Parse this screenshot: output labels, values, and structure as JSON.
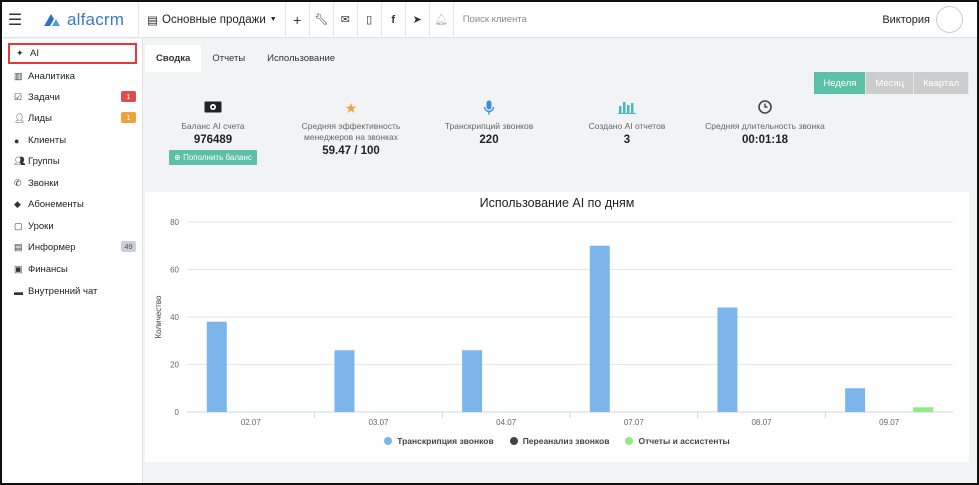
{
  "topbar": {
    "logo": "alfacrm",
    "branch": "Основные продажи",
    "search_placeholder": "Поиск клиента",
    "user_name": "Виктория"
  },
  "sidebar": {
    "items": [
      {
        "label": "AI",
        "icon": "sparkle-icon"
      },
      {
        "label": "Аналитика",
        "icon": "map-icon"
      },
      {
        "label": "Задачи",
        "icon": "tasks-icon",
        "badge": "1",
        "badge_color": "#e24b4b"
      },
      {
        "label": "Лиды",
        "icon": "leads-icon",
        "badge": "1",
        "badge_color": "#f0a23a"
      },
      {
        "label": "Клиенты",
        "icon": "user-icon"
      },
      {
        "label": "Группы",
        "icon": "users-icon"
      },
      {
        "label": "Звонки",
        "icon": "phone-icon"
      },
      {
        "label": "Абонементы",
        "icon": "tag-icon"
      },
      {
        "label": "Уроки",
        "icon": "calendar-icon"
      },
      {
        "label": "Информер",
        "icon": "informer-icon",
        "badge": "49",
        "badge_color": "#c8cfd6"
      },
      {
        "label": "Финансы",
        "icon": "money-icon"
      },
      {
        "label": "Внутренний чат",
        "icon": "chat-icon"
      }
    ]
  },
  "tabs": [
    "Сводка",
    "Отчеты",
    "Использование"
  ],
  "periods": [
    "Неделя",
    "Месяц",
    "Квартал"
  ],
  "stats": [
    {
      "label": "Баланс AI счета",
      "value": "976489",
      "button": "Пополнить баланс",
      "icon": "money-icon",
      "color": "#222"
    },
    {
      "label": "Средняя эффективность менеджеров на звонках",
      "value": "59.47 / 100",
      "icon": "star-icon",
      "color": "#f0a23a"
    },
    {
      "label": "Транскрипций звонков",
      "value": "220",
      "icon": "microphone-icon",
      "color": "#3b8fd8"
    },
    {
      "label": "Создано AI отчетов",
      "value": "3",
      "icon": "bar-chart-icon",
      "color": "#49b5c8"
    },
    {
      "label": "Средняя длительность звонка",
      "value": "00:01:18",
      "icon": "clock-icon",
      "color": "#444"
    }
  ],
  "colors": {
    "accent": "#5cbfa7",
    "active_outline": "#e53935"
  },
  "chart_data": {
    "type": "bar",
    "title": "Использование AI по дням",
    "ylabel": "Количество",
    "xlabel": "",
    "categories": [
      "02.07",
      "03.07",
      "04.07",
      "07.07",
      "08.07",
      "09.07"
    ],
    "ylim": [
      0,
      80
    ],
    "yticks": [
      0,
      20,
      40,
      60,
      80
    ],
    "series": [
      {
        "name": "Транскрипция звонков",
        "color": "#7cb5ec",
        "values": [
          38,
          26,
          26,
          70,
          44,
          10
        ]
      },
      {
        "name": "Переанализ звонков",
        "color": "#434348",
        "values": [
          0,
          0,
          0,
          0,
          0,
          0
        ]
      },
      {
        "name": "Отчеты и ассистенты",
        "color": "#90ed7d",
        "values": [
          0,
          0,
          0,
          0,
          0,
          2
        ]
      }
    ],
    "grid": true,
    "legend": "bottom"
  }
}
